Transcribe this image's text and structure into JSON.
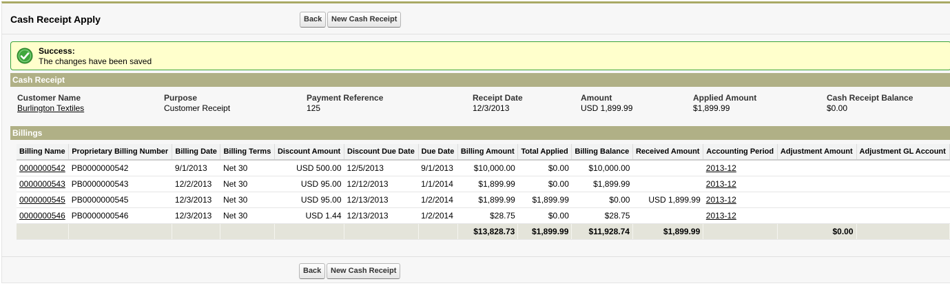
{
  "page": {
    "title": "Cash Receipt Apply"
  },
  "buttons": {
    "back": "Back",
    "new_cash_receipt": "New Cash Receipt"
  },
  "message": {
    "title": "Success:",
    "text": "The changes have been saved",
    "icon": "check-icon"
  },
  "cash_receipt": {
    "section_title": "Cash Receipt",
    "fields": [
      {
        "label": "Customer Name",
        "value": "Burlington Textiles",
        "link": true
      },
      {
        "label": "Purpose",
        "value": "Customer Receipt",
        "link": false
      },
      {
        "label": "Payment Reference",
        "value": "125",
        "link": false
      },
      {
        "label": "Receipt Date",
        "value": "12/3/2013",
        "link": false
      },
      {
        "label": "Amount",
        "value": "USD 1,899.99",
        "link": false
      },
      {
        "label": "Applied Amount",
        "value": "$1,899.99",
        "link": false
      },
      {
        "label": "Cash Receipt Balance",
        "value": "$0.00",
        "link": false
      }
    ]
  },
  "billings": {
    "section_title": "Billings",
    "columns": [
      "Billing Name",
      "Proprietary Billing Number",
      "Billing Date",
      "Billing Terms",
      "Discount Amount",
      "Discount Due Date",
      "Due Date",
      "Billing Amount",
      "Total Applied",
      "Billing Balance",
      "Received Amount",
      "Accounting Period",
      "Adjustment Amount",
      "Adjustment GL Account"
    ],
    "rows": [
      [
        "0000000542",
        "PB0000000542",
        "9/1/2013",
        "Net 30",
        "USD 500.00",
        "12/5/2013",
        "9/1/2013",
        "$10,000.00",
        "$0.00",
        "$10,000.00",
        "",
        "2013-12",
        "",
        ""
      ],
      [
        "0000000543",
        "PB0000000543",
        "12/2/2013",
        "Net 30",
        "USD 95.00",
        "12/12/2013",
        "1/1/2014",
        "$1,899.99",
        "$0.00",
        "$1,899.99",
        "",
        "2013-12",
        "",
        ""
      ],
      [
        "0000000545",
        "PB0000000545",
        "12/3/2013",
        "Net 30",
        "USD 95.00",
        "12/13/2013",
        "1/2/2014",
        "$1,899.99",
        "$1,899.99",
        "$0.00",
        "USD 1,899.99",
        "2013-12",
        "",
        ""
      ],
      [
        "0000000546",
        "PB0000000546",
        "12/3/2013",
        "Net 30",
        "USD 1.44",
        "12/13/2013",
        "1/2/2014",
        "$28.75",
        "$0.00",
        "$28.75",
        "",
        "2013-12",
        "",
        ""
      ]
    ],
    "totals": [
      "",
      "",
      "",
      "",
      "",
      "",
      "",
      "$13,828.73",
      "$1,899.99",
      "$11,928.74",
      "$1,899.99",
      "",
      "$0.00",
      ""
    ]
  }
}
